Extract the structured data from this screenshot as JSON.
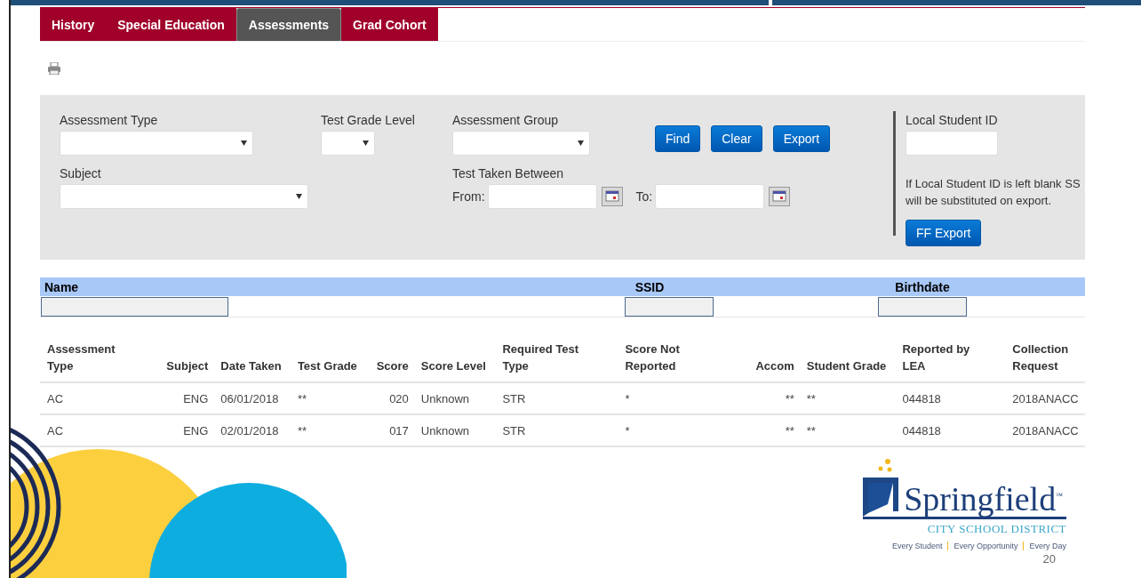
{
  "tabs": [
    {
      "label": "History",
      "selected": false
    },
    {
      "label": "Special Education",
      "selected": false
    },
    {
      "label": "Assessments",
      "selected": true
    },
    {
      "label": "Grad Cohort",
      "selected": false
    }
  ],
  "filters": {
    "assessment_type": {
      "label": "Assessment Type"
    },
    "test_grade_level": {
      "label": "Test Grade Level"
    },
    "assessment_group": {
      "label": "Assessment Group"
    },
    "subject": {
      "label": "Subject"
    },
    "test_taken_between": {
      "label": "Test Taken Between",
      "from_label": "From:",
      "to_label": "To:"
    }
  },
  "buttons": [
    "Find",
    "Clear",
    "Export"
  ],
  "local_student_id": {
    "label": "Local Student ID",
    "note_lines": [
      "If Local Student ID is left blank SS",
      "will be substituted on export."
    ],
    "button": "FF Export"
  },
  "search_bar": {
    "columns": [
      "Name",
      "SSID",
      "Birthdate"
    ]
  },
  "table": {
    "columns": [
      "Assessment Type",
      "Subject",
      "Date Taken",
      "Test Grade",
      "Score",
      "Score Level",
      "Required Test Type",
      "Score Not Reported",
      "Accom",
      "Student Grade",
      "Reported by LEA",
      "Collection Request"
    ],
    "rows": [
      [
        "AC",
        "ENG",
        "06/01/2018",
        "**",
        "020",
        "Unknown",
        "STR",
        "*",
        "**",
        "**",
        "044818",
        "2018ANACC"
      ],
      [
        "AC",
        "ENG",
        "02/01/2018",
        "**",
        "017",
        "Unknown",
        "STR",
        "*",
        "**",
        "**",
        "044818",
        "2018ANACC"
      ]
    ]
  },
  "logo": {
    "name": "Springfield",
    "trademark": "™",
    "subtitle": "CITY SCHOOL DISTRICT",
    "tagline": [
      "Every Student",
      "Every Opportunity",
      "Every Day"
    ]
  },
  "page_number": "20"
}
